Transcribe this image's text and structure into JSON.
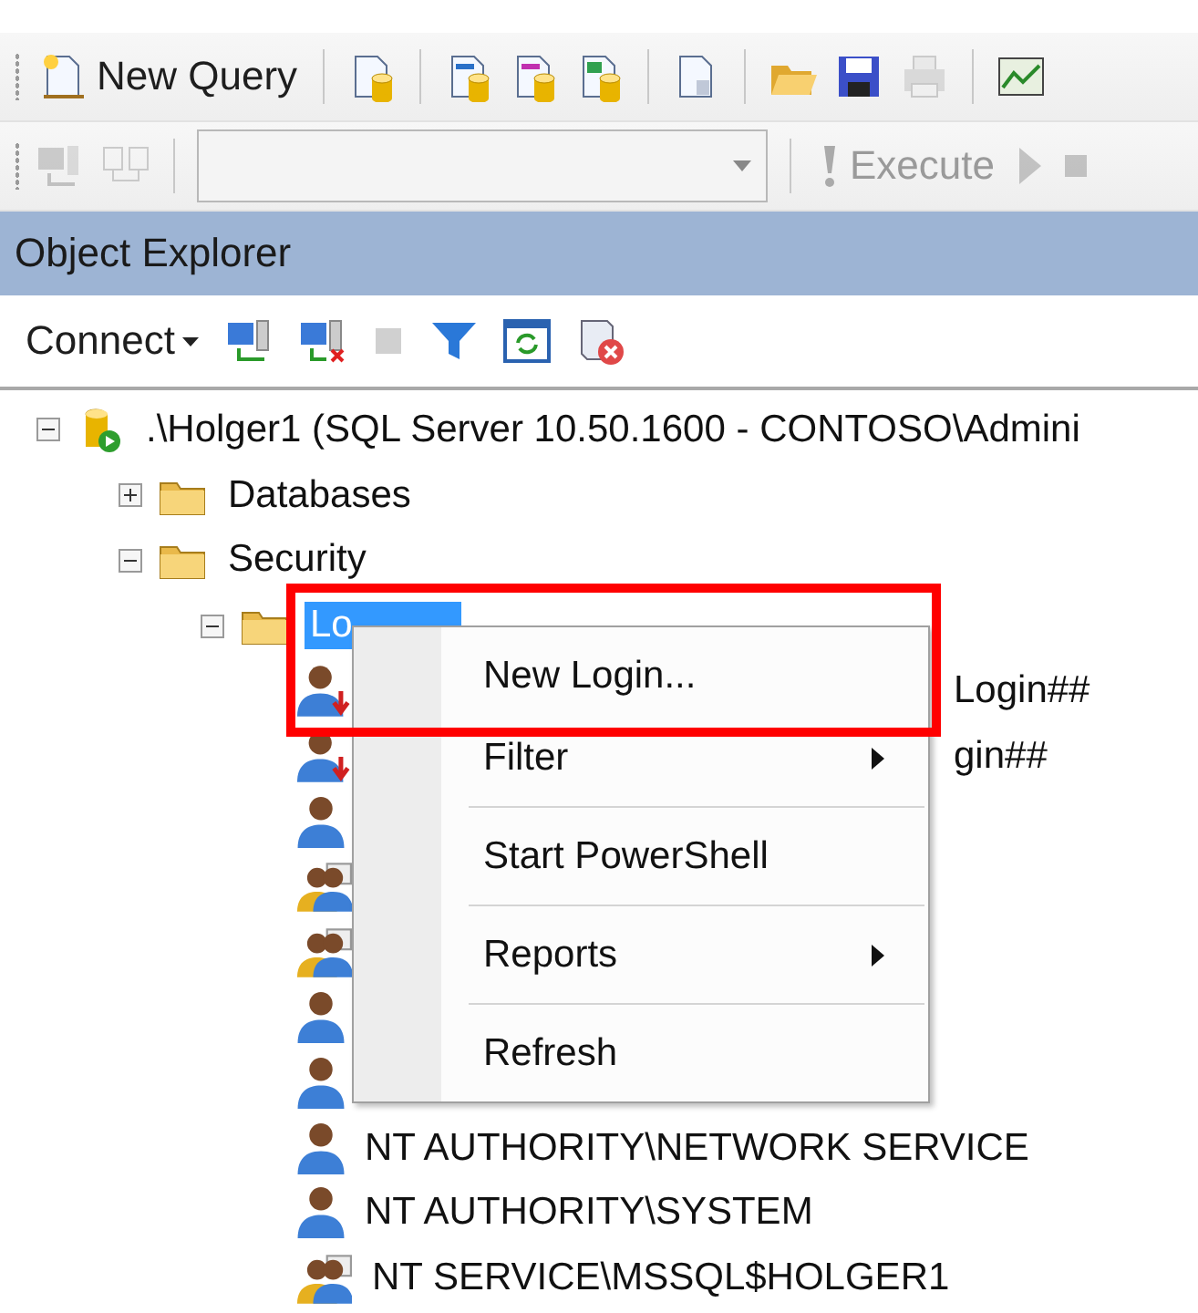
{
  "standard_toolbar": {
    "new_query": {
      "label": "New Query"
    },
    "print": {
      "disabled": true
    }
  },
  "sql_toolbar": {
    "execute": {
      "label": "Execute",
      "disabled": true
    }
  },
  "object_explorer": {
    "title": "Object Explorer",
    "connect": {
      "label": "Connect"
    },
    "tree": [
      {
        "label": ".\\Holger1 (SQL Server 10.50.1600 - CONTOSO\\Admini",
        "kind": "server",
        "expanded": true,
        "selected": false,
        "children": [
          {
            "label": "Databases",
            "kind": "folder",
            "expanded": false,
            "selected": false
          },
          {
            "label": "Security",
            "kind": "folder",
            "expanded": true,
            "selected": false,
            "children": [
              {
                "label": "Lo",
                "kind": "folder",
                "expanded": true,
                "selected": true,
                "children": [
                  {
                    "label": "Login##",
                    "kind": "login-disabled",
                    "covered": true,
                    "selected": false
                  },
                  {
                    "label": "gin##",
                    "kind": "login-disabled",
                    "covered": true,
                    "selected": false
                  },
                  {
                    "kind": "login",
                    "selected": false
                  },
                  {
                    "kind": "group",
                    "selected": false
                  },
                  {
                    "kind": "group",
                    "selected": false
                  },
                  {
                    "kind": "login",
                    "selected": false
                  },
                  {
                    "kind": "login",
                    "selected": false
                  },
                  {
                    "label": "NT AUTHORITY\\NETWORK SERVICE",
                    "kind": "login",
                    "selected": false
                  },
                  {
                    "label": "NT AUTHORITY\\SYSTEM",
                    "kind": "login",
                    "selected": false
                  },
                  {
                    "label": "NT SERVICE\\MSSQL$HOLGER1",
                    "kind": "group",
                    "selected": false
                  }
                ]
              }
            ]
          }
        ]
      }
    ]
  },
  "context_menu": {
    "items": [
      {
        "kind": "item",
        "label": "New Login...",
        "submenu": false
      },
      {
        "kind": "item",
        "label": "Filter",
        "submenu": true
      },
      {
        "kind": "separator"
      },
      {
        "kind": "item",
        "label": "Start PowerShell",
        "submenu": false
      },
      {
        "kind": "separator"
      },
      {
        "kind": "item",
        "label": "Reports",
        "submenu": true
      },
      {
        "kind": "separator"
      },
      {
        "kind": "item",
        "label": "Refresh",
        "submenu": false
      }
    ]
  }
}
